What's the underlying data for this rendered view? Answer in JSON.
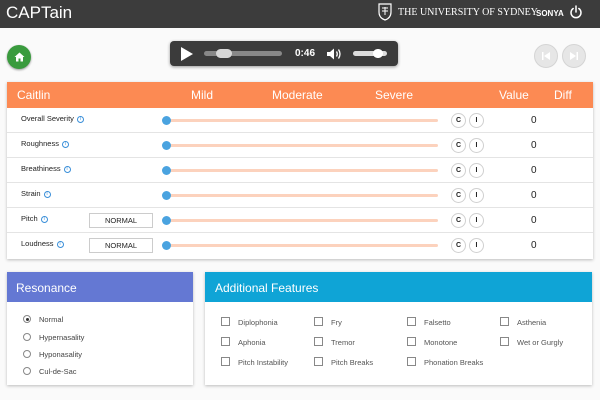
{
  "header": {
    "app_title": "CAPTain",
    "university": "THE UNIVERSITY OF SYDNEY",
    "user": "SONYA"
  },
  "player": {
    "time": "0:46",
    "progress": 0.2,
    "volume": 0.85
  },
  "rating": {
    "columns": {
      "name": "Caitlin",
      "mild": "Mild",
      "moderate": "Moderate",
      "severe": "Severe",
      "value": "Value",
      "diff": "Diff"
    },
    "rows": [
      {
        "label": "Overall Severity",
        "value": "0",
        "c": "C",
        "i": "I"
      },
      {
        "label": "Roughness",
        "value": "0",
        "c": "C",
        "i": "I"
      },
      {
        "label": "Breathiness",
        "value": "0",
        "c": "C",
        "i": "I"
      },
      {
        "label": "Strain",
        "value": "0",
        "c": "C",
        "i": "I"
      },
      {
        "label": "Pitch",
        "value": "0",
        "c": "C",
        "i": "I",
        "selector": "NORMAL"
      },
      {
        "label": "Loudness",
        "value": "0",
        "c": "C",
        "i": "I",
        "selector": "NORMAL"
      }
    ]
  },
  "resonance": {
    "title": "Resonance",
    "options": [
      "Normal",
      "Hypernasality",
      "Hyponasality",
      "Cul-de-Sac"
    ],
    "selected": "Normal"
  },
  "features": {
    "title": "Additional Features",
    "items": [
      "Diplophonia",
      "Fry",
      "Falsetto",
      "Asthenia",
      "Aphonia",
      "Tremor",
      "Monotone",
      "Wet or Gurgly",
      "Pitch Instability",
      "Pitch Breaks",
      "Phonation Breaks"
    ]
  },
  "colors": {
    "rating_header": "#fc8a53",
    "resonance_header": "#6478d3",
    "features_header": "#0fa4d6",
    "home_button": "#3a9b3e",
    "slider_knob": "#4aa3e0"
  }
}
